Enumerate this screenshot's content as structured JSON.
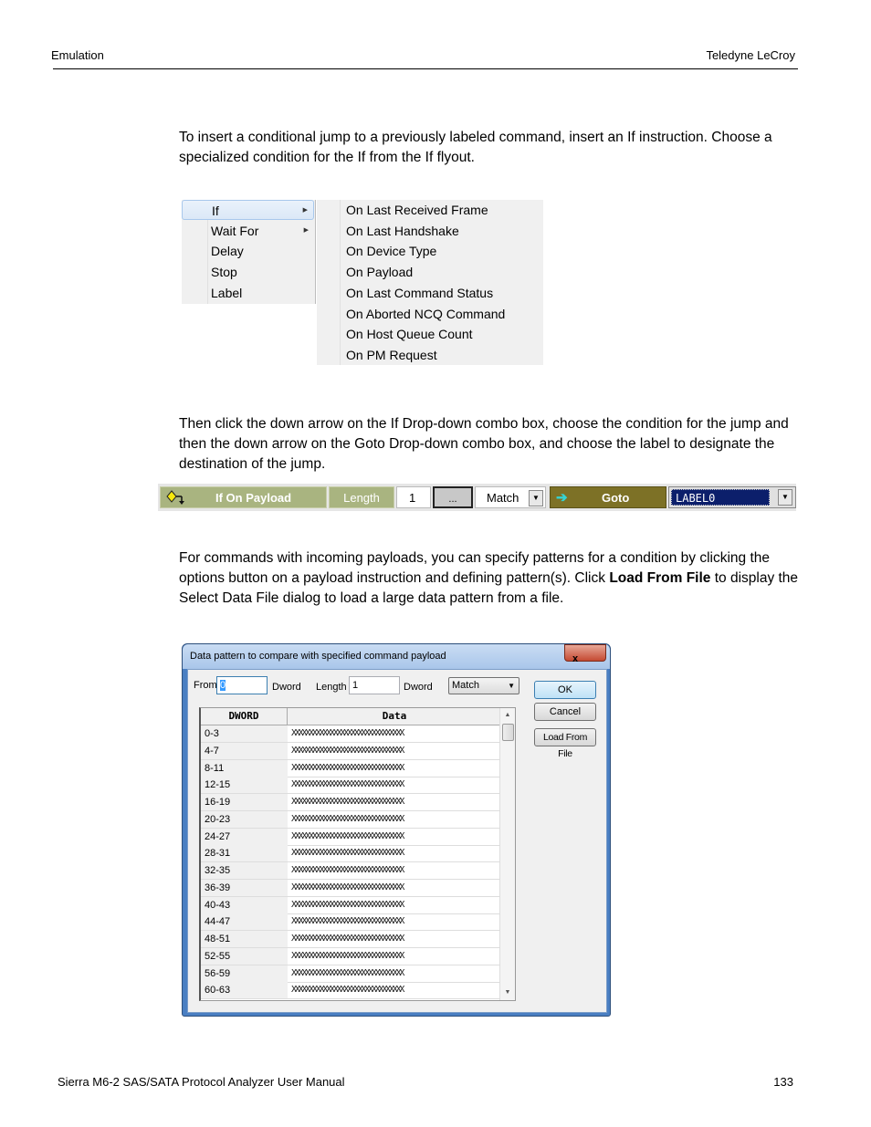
{
  "header": {
    "left": "Emulation",
    "right": "Teledyne LeCroy"
  },
  "paragraphs": {
    "p1": "To insert a conditional jump to a previously labeled command, insert an If instruction. Choose a specialized condition for the If from the If flyout.",
    "p2": "Then click the down arrow on the If Drop-down combo box, choose the condition for the jump and then the down arrow on the Goto Drop-down combo box, and choose the label to designate the destination of the jump.",
    "p3_a": "For commands with incoming payloads, you can specify patterns for a condition by clicking the options button on a payload instruction and defining pattern(s). Click ",
    "p3_bold": "Load From File",
    "p3_b": " to display the Select Data File dialog to load a large data pattern from a file."
  },
  "context_menu": {
    "items": [
      {
        "label": "If",
        "has_submenu": true,
        "selected": true
      },
      {
        "label": "Wait For",
        "has_submenu": true,
        "selected": false
      },
      {
        "label": "Delay",
        "has_submenu": false,
        "selected": false
      },
      {
        "label": "Stop",
        "has_submenu": false,
        "selected": false
      },
      {
        "label": "Label",
        "has_submenu": false,
        "selected": false
      }
    ],
    "submenu_icon": "chevron-right-icon"
  },
  "if_flyout": {
    "items": [
      "On Last Received Frame",
      "On Last Handshake",
      "On Device Type",
      "On Payload",
      "On Last Command Status",
      "On Aborted NCQ Command",
      "On Host Queue Count",
      "On PM Request"
    ]
  },
  "instruction_strip": {
    "if_icon": "conditional-branch-icon",
    "if_label": "If On Payload",
    "length_label": "Length",
    "length_value": "1",
    "options_button": "...",
    "match_value": "Match",
    "goto_icon": "arrow-right-icon",
    "goto_label": "Goto",
    "label_value": "LABEL0",
    "colors": {
      "if_cell": "#a9b480",
      "goto_cell": "#7d7126",
      "label_selected": "#0c1f6b",
      "goto_arrow": "#35d4d4"
    }
  },
  "dialog": {
    "title": "Data pattern to compare with specified command payload",
    "close_label": "x",
    "from_label": "From",
    "from_value": "0",
    "from_unit": "Dword",
    "length_label": "Length",
    "length_value": "1",
    "length_unit": "Dword",
    "match_value": "Match",
    "ok_label": "OK",
    "cancel_label": "Cancel",
    "load_label": "Load From File",
    "grid": {
      "columns": [
        "DWORD",
        "Data"
      ],
      "rows": [
        {
          "dword": "0-3",
          "data": "XXXXXXXXXXXXXXXXXXXXXXXXXXXXXXXX"
        },
        {
          "dword": "4-7",
          "data": "XXXXXXXXXXXXXXXXXXXXXXXXXXXXXXXX"
        },
        {
          "dword": "8-11",
          "data": "XXXXXXXXXXXXXXXXXXXXXXXXXXXXXXXX"
        },
        {
          "dword": "12-15",
          "data": "XXXXXXXXXXXXXXXXXXXXXXXXXXXXXXXX"
        },
        {
          "dword": "16-19",
          "data": "XXXXXXXXXXXXXXXXXXXXXXXXXXXXXXXX"
        },
        {
          "dword": "20-23",
          "data": "XXXXXXXXXXXXXXXXXXXXXXXXXXXXXXXX"
        },
        {
          "dword": "24-27",
          "data": "XXXXXXXXXXXXXXXXXXXXXXXXXXXXXXXX"
        },
        {
          "dword": "28-31",
          "data": "XXXXXXXXXXXXXXXXXXXXXXXXXXXXXXXX"
        },
        {
          "dword": "32-35",
          "data": "XXXXXXXXXXXXXXXXXXXXXXXXXXXXXXXX"
        },
        {
          "dword": "36-39",
          "data": "XXXXXXXXXXXXXXXXXXXXXXXXXXXXXXXX"
        },
        {
          "dword": "40-43",
          "data": "XXXXXXXXXXXXXXXXXXXXXXXXXXXXXXXX"
        },
        {
          "dword": "44-47",
          "data": "XXXXXXXXXXXXXXXXXXXXXXXXXXXXXXXX"
        },
        {
          "dword": "48-51",
          "data": "XXXXXXXXXXXXXXXXXXXXXXXXXXXXXXXX"
        },
        {
          "dword": "52-55",
          "data": "XXXXXXXXXXXXXXXXXXXXXXXXXXXXXXXX"
        },
        {
          "dword": "56-59",
          "data": "XXXXXXXXXXXXXXXXXXXXXXXXXXXXXXXX"
        },
        {
          "dword": "60-63",
          "data": "XXXXXXXXXXXXXXXXXXXXXXXXXXXXXXXX"
        }
      ]
    }
  },
  "footer": {
    "left": "Sierra M6-2 SAS/SATA Protocol Analyzer User Manual",
    "page_number": "133"
  }
}
